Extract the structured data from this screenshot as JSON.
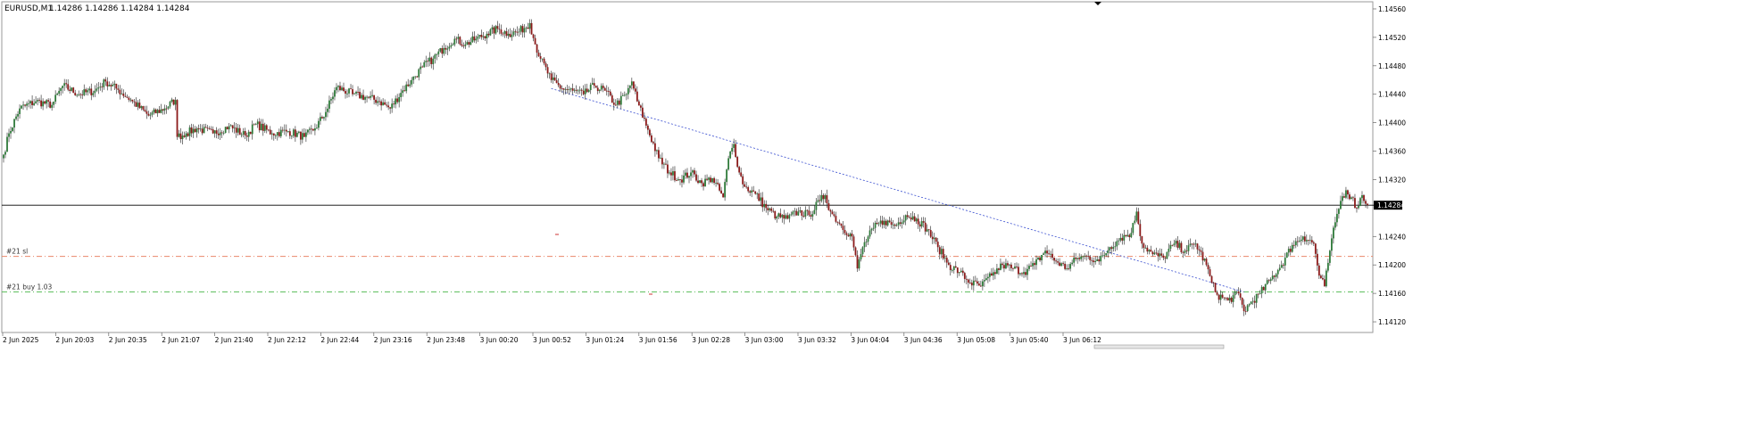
{
  "header": {
    "symbol": "EURUSD,M1",
    "ohlc": "1.14286 1.14286 1.14284 1.14284"
  },
  "price_axis": {
    "ticks": [
      "1.14560",
      "1.14520",
      "1.14480",
      "1.14440",
      "1.14400",
      "1.14360",
      "1.14320",
      "1.14240",
      "1.14200",
      "1.14160",
      "1.14120"
    ],
    "current_price_label": "1.14284"
  },
  "time_axis": {
    "ticks": [
      "2 Jun 2025",
      "2 Jun 20:03",
      "2 Jun 20:35",
      "2 Jun 21:07",
      "2 Jun 21:40",
      "2 Jun 22:12",
      "2 Jun 22:44",
      "2 Jun 23:16",
      "2 Jun 23:48",
      "3 Jun 00:20",
      "3 Jun 00:52",
      "3 Jun 01:24",
      "3 Jun 01:56",
      "3 Jun 02:28",
      "3 Jun 03:00",
      "3 Jun 03:32",
      "3 Jun 04:04",
      "3 Jun 04:36",
      "3 Jun 05:08",
      "3 Jun 05:40",
      "3 Jun 06:12"
    ]
  },
  "levels": {
    "sl": {
      "label": "#21 sl",
      "price": 1.14212,
      "color": "#e9866a"
    },
    "entry": {
      "label": "#21 buy 1.03",
      "price": 1.14162,
      "color": "#5fbf5f"
    },
    "current": {
      "price": 1.14284,
      "color": "#000000"
    }
  },
  "colors": {
    "bull": "#2f7a3a",
    "bear": "#8b1a1a",
    "trade_line": "#3a4fd0",
    "grid_border": "#9a9a9a"
  },
  "chart_data": {
    "type": "candlestick",
    "timeframe": "M1",
    "ylim": [
      1.14105,
      1.1457
    ],
    "anchors": [
      [
        0,
        1.14355
      ],
      [
        3,
        1.14385
      ],
      [
        9,
        1.1442
      ],
      [
        18,
        1.1443
      ],
      [
        27,
        1.14425
      ],
      [
        33,
        1.14452
      ],
      [
        42,
        1.1444
      ],
      [
        51,
        1.14445
      ],
      [
        57,
        1.14458
      ],
      [
        63,
        1.14448
      ],
      [
        72,
        1.1443
      ],
      [
        81,
        1.1441
      ],
      [
        90,
        1.1442
      ],
      [
        96,
        1.14432
      ],
      [
        97,
        1.1438
      ],
      [
        102,
        1.14385
      ],
      [
        108,
        1.14392
      ],
      [
        117,
        1.14385
      ],
      [
        126,
        1.14395
      ],
      [
        135,
        1.14382
      ],
      [
        141,
        1.14398
      ],
      [
        150,
        1.14385
      ],
      [
        159,
        1.14388
      ],
      [
        168,
        1.1438
      ],
      [
        174,
        1.14392
      ],
      [
        180,
        1.14415
      ],
      [
        186,
        1.1445
      ],
      [
        195,
        1.1444
      ],
      [
        204,
        1.14435
      ],
      [
        210,
        1.1443
      ],
      [
        216,
        1.1442
      ],
      [
        222,
        1.14442
      ],
      [
        228,
        1.1446
      ],
      [
        234,
        1.14478
      ],
      [
        240,
        1.1449
      ],
      [
        246,
        1.14505
      ],
      [
        252,
        1.14518
      ],
      [
        258,
        1.1451
      ],
      [
        264,
        1.14518
      ],
      [
        270,
        1.14525
      ],
      [
        276,
        1.14532
      ],
      [
        282,
        1.14525
      ],
      [
        288,
        1.14528
      ],
      [
        294,
        1.1454
      ],
      [
        297,
        1.1451
      ],
      [
        300,
        1.1449
      ],
      [
        306,
        1.1446
      ],
      [
        312,
        1.14448
      ],
      [
        318,
        1.14445
      ],
      [
        324,
        1.1444
      ],
      [
        330,
        1.14452
      ],
      [
        336,
        1.14445
      ],
      [
        342,
        1.14425
      ],
      [
        348,
        1.1444
      ],
      [
        351,
        1.14458
      ],
      [
        354,
        1.1443
      ],
      [
        360,
        1.1439
      ],
      [
        366,
        1.1435
      ],
      [
        372,
        1.1433
      ],
      [
        378,
        1.1432
      ],
      [
        384,
        1.1433
      ],
      [
        390,
        1.14315
      ],
      [
        396,
        1.14322
      ],
      [
        402,
        1.14295
      ],
      [
        405,
        1.1435
      ],
      [
        408,
        1.1437
      ],
      [
        411,
        1.1433
      ],
      [
        414,
        1.1431
      ],
      [
        420,
        1.143
      ],
      [
        426,
        1.1428
      ],
      [
        432,
        1.14268
      ],
      [
        438,
        1.14265
      ],
      [
        444,
        1.14275
      ],
      [
        450,
        1.1427
      ],
      [
        456,
        1.1429
      ],
      [
        459,
        1.14298
      ],
      [
        462,
        1.14275
      ],
      [
        468,
        1.14255
      ],
      [
        474,
        1.1424
      ],
      [
        477,
        1.14195
      ],
      [
        480,
        1.14225
      ],
      [
        486,
        1.14252
      ],
      [
        492,
        1.14262
      ],
      [
        498,
        1.14255
      ],
      [
        504,
        1.1427
      ],
      [
        510,
        1.14265
      ],
      [
        516,
        1.1425
      ],
      [
        522,
        1.14225
      ],
      [
        528,
        1.142
      ],
      [
        534,
        1.1419
      ],
      [
        540,
        1.14175
      ],
      [
        546,
        1.1417
      ],
      [
        552,
        1.14185
      ],
      [
        558,
        1.142
      ],
      [
        564,
        1.14195
      ],
      [
        570,
        1.1419
      ],
      [
        576,
        1.142
      ],
      [
        582,
        1.1422
      ],
      [
        588,
        1.14205
      ],
      [
        594,
        1.14195
      ],
      [
        600,
        1.1421
      ],
      [
        606,
        1.14212
      ],
      [
        612,
        1.14205
      ],
      [
        618,
        1.14225
      ],
      [
        624,
        1.14238
      ],
      [
        630,
        1.14245
      ],
      [
        633,
        1.14275
      ],
      [
        636,
        1.1423
      ],
      [
        642,
        1.14215
      ],
      [
        648,
        1.1421
      ],
      [
        654,
        1.1423
      ],
      [
        660,
        1.1422
      ],
      [
        666,
        1.1423
      ],
      [
        672,
        1.142
      ],
      [
        675,
        1.14175
      ],
      [
        678,
        1.14158
      ],
      [
        684,
        1.1415
      ],
      [
        690,
        1.1416
      ],
      [
        693,
        1.14135
      ],
      [
        696,
        1.14145
      ],
      [
        702,
        1.1416
      ],
      [
        708,
        1.1418
      ],
      [
        714,
        1.142
      ],
      [
        720,
        1.14228
      ],
      [
        726,
        1.1424
      ],
      [
        732,
        1.1423
      ],
      [
        735,
        1.14185
      ],
      [
        738,
        1.1417
      ],
      [
        741,
        1.1422
      ],
      [
        744,
        1.1426
      ],
      [
        747,
        1.1429
      ],
      [
        750,
        1.14305
      ],
      [
        753,
        1.14295
      ],
      [
        756,
        1.1428
      ],
      [
        759,
        1.14298
      ],
      [
        762,
        1.14284
      ]
    ]
  }
}
